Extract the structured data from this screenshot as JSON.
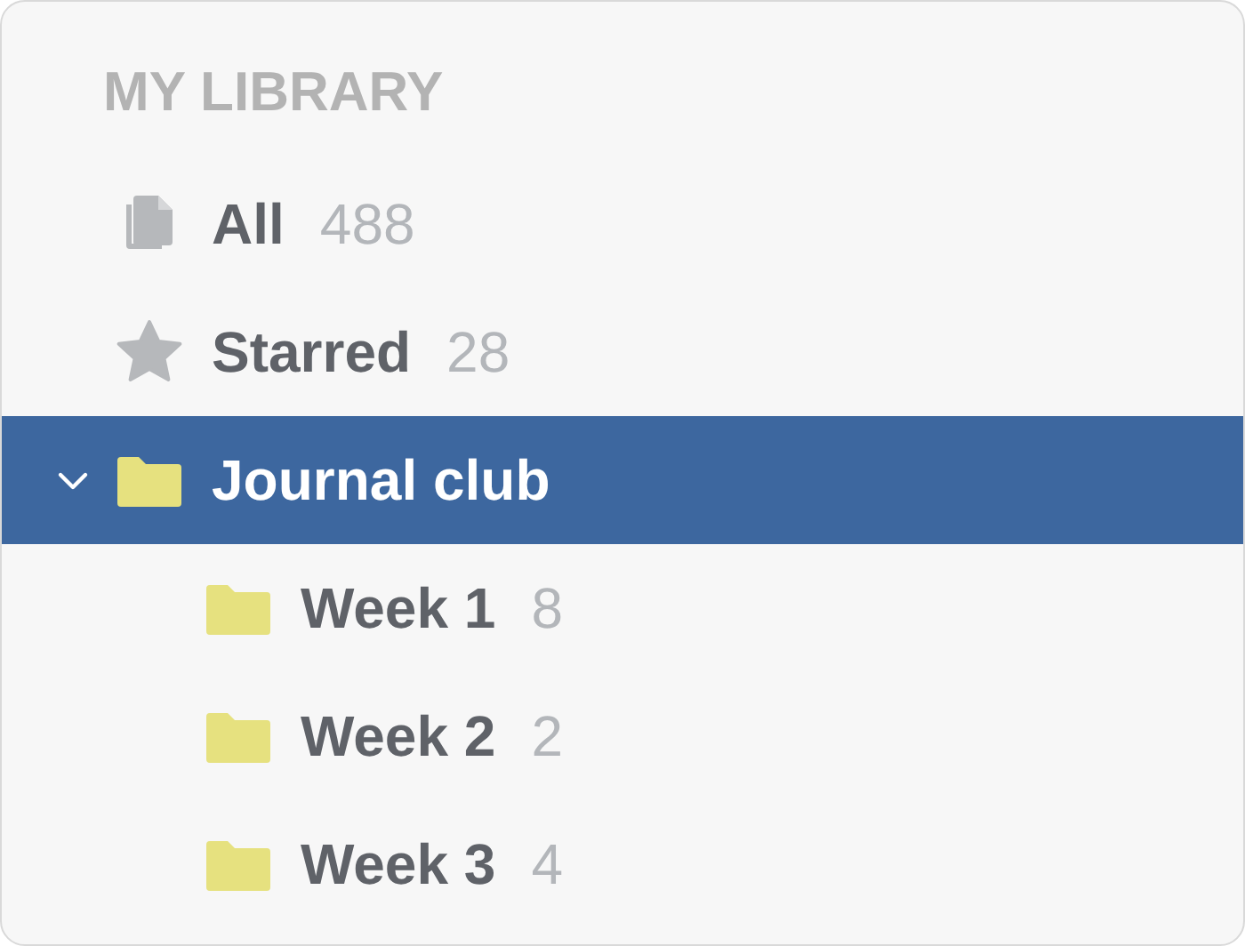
{
  "sidebar": {
    "heading": "MY LIBRARY",
    "items": [
      {
        "kind": "all",
        "label": "All",
        "count": "488",
        "selected": false
      },
      {
        "kind": "starred",
        "label": "Starred",
        "count": "28",
        "selected": false
      },
      {
        "kind": "folder",
        "label": "Journal club",
        "selected": true,
        "expanded": true,
        "children": [
          {
            "kind": "folder",
            "label": "Week 1",
            "count": "8",
            "selected": false
          },
          {
            "kind": "folder",
            "label": "Week 2",
            "count": "2",
            "selected": false
          },
          {
            "kind": "folder",
            "label": "Week 3",
            "count": "4",
            "selected": false
          }
        ]
      }
    ]
  }
}
